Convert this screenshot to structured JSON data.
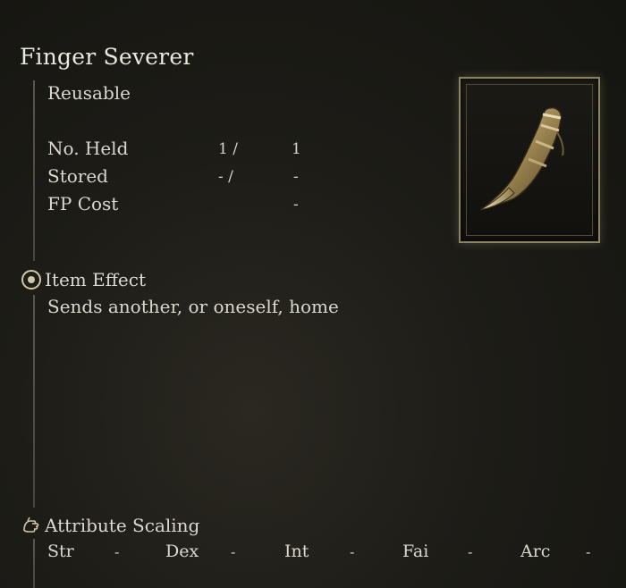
{
  "item": {
    "name": "Finger Severer",
    "type": "Reusable",
    "image_icon": "severed-finger-item-icon"
  },
  "stats": [
    {
      "label": "No. Held",
      "current": "1 /",
      "max": "1"
    },
    {
      "label": "Stored",
      "current": "- /",
      "max": "-"
    },
    {
      "label": "FP Cost",
      "current": "",
      "max": "-"
    }
  ],
  "item_effect": {
    "heading": "Item Effect",
    "icon": "effect-orb-icon",
    "description": "Sends another, or oneself, home"
  },
  "attribute_scaling": {
    "heading": "Attribute Scaling",
    "icon": "hand-scaling-icon",
    "attributes": [
      {
        "name": "Str",
        "value": "-"
      },
      {
        "name": "Dex",
        "value": "-"
      },
      {
        "name": "Int",
        "value": "-"
      },
      {
        "name": "Fai",
        "value": "-"
      },
      {
        "name": "Arc",
        "value": "-"
      }
    ]
  },
  "colors": {
    "text": "#dcd8ce",
    "accent_gold": "#cfc8a9",
    "background": "#1d1c17"
  }
}
